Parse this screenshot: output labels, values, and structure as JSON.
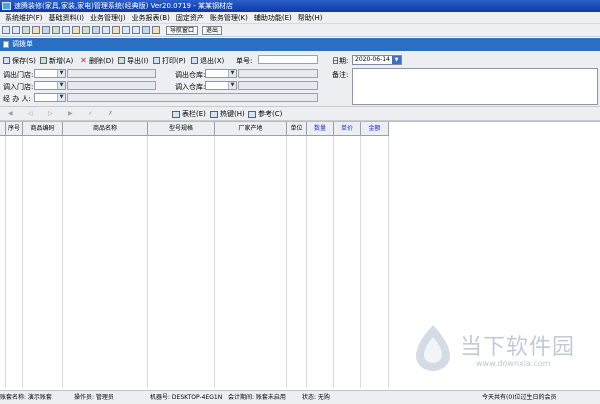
{
  "window": {
    "title": "速腾装修(家具,家装,家电)管理系统(经典版) Ver20.0719 - 某某钢材店"
  },
  "menu": [
    "系统维护(F)",
    "基础资料(I)",
    "业务管理(J)",
    "业务报表(B)",
    "固定资产",
    "账务管理(K)",
    "辅助功能(E)",
    "帮助(H)"
  ],
  "toolbar": {
    "nav_window_label": "导航窗口",
    "exit_label": "退出"
  },
  "panel": {
    "title": "调拨单"
  },
  "actions": {
    "save": "保存(S)",
    "add": "新增(A)",
    "delete": "删除(D)",
    "export": "导出(I)",
    "print": "打印(P)",
    "exit": "退出(X)"
  },
  "form": {
    "doc_no_label": "单号:",
    "date_label": "日期:",
    "date_value": "2020-06-14",
    "out_store_label": "调出门店:",
    "out_warehouse_label": "调出仓库:",
    "in_store_label": "调入门店:",
    "in_warehouse_label": "调入仓库:",
    "handler_label": "经 办 人:",
    "notes_label": "备注:"
  },
  "strip": {
    "columns_label": "表栏(E)",
    "hotkey_label": "热键(H)",
    "reference_label": "参考(C)"
  },
  "grid": {
    "columns": [
      {
        "label": "序号",
        "highlight": false
      },
      {
        "label": "商品编码",
        "highlight": false
      },
      {
        "label": "商品名称",
        "highlight": false
      },
      {
        "label": "型号规格",
        "highlight": false
      },
      {
        "label": "厂家产地",
        "highlight": false
      },
      {
        "label": "单位",
        "highlight": false
      },
      {
        "label": "数量",
        "highlight": true
      },
      {
        "label": "单价",
        "highlight": true
      },
      {
        "label": "金额",
        "highlight": true
      }
    ]
  },
  "status": {
    "account": "账套名称: 演示账套",
    "operator": "操作员: 管理员",
    "machine": "机器号: DESKTOP-4EG1N",
    "period": "会计期间: 账套未启用",
    "state": "状态: 无购",
    "birthday": "今天共有(0)位过生日的会员"
  },
  "watermark": {
    "text": "当下软件园",
    "url": "www.downxia.com"
  },
  "colors": {
    "title_bar": "#0a3aa8",
    "panel_title": "#2c6fc2",
    "highlight_header": "#1e35c9"
  }
}
